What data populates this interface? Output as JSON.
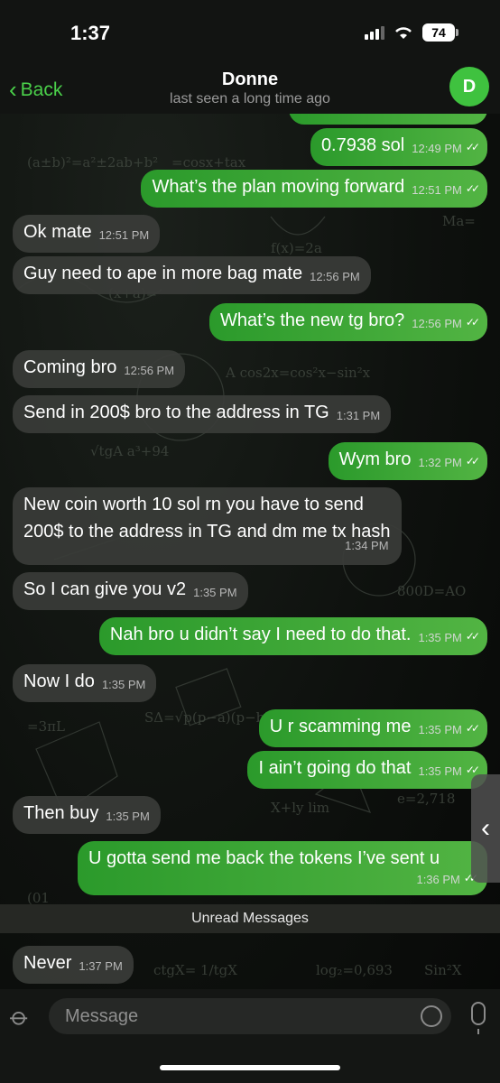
{
  "status": {
    "time": "1:37",
    "battery": "74"
  },
  "header": {
    "back_label": "Back",
    "contact_name": "Donne",
    "last_seen": "last seen a long time ago",
    "avatar_initial": "D"
  },
  "messages": [
    {
      "dir": "out",
      "text": "0.7938 sol",
      "time": "12:49 PM"
    },
    {
      "dir": "out",
      "text": "What’s the plan moving forward",
      "time": "12:51 PM"
    },
    {
      "dir": "in",
      "text": "Ok mate",
      "time": "12:51 PM"
    },
    {
      "dir": "in",
      "text": "Guy need to ape in more bag mate",
      "time": "12:56 PM"
    },
    {
      "dir": "out",
      "text": "What’s the new tg bro?",
      "time": "12:56 PM"
    },
    {
      "dir": "in",
      "text": "Coming bro",
      "time": "12:56 PM"
    },
    {
      "dir": "in",
      "text": "Send in 200$ bro to the address in TG",
      "time": "1:31 PM"
    },
    {
      "dir": "out",
      "text": "Wym bro",
      "time": "1:32 PM"
    },
    {
      "dir": "in",
      "text": "New coin worth 10 sol rn you have to send",
      "text2": "200$ to the address in TG and dm me tx hash",
      "time": "1:34 PM"
    },
    {
      "dir": "in",
      "text": "So I can give you v2",
      "time": "1:35 PM"
    },
    {
      "dir": "out",
      "text": "Nah bro u didn’t say I need to do that.",
      "time": "1:35 PM"
    },
    {
      "dir": "in",
      "text": "Now I do",
      "time": "1:35 PM"
    },
    {
      "dir": "out",
      "text": "U r scamming me",
      "time": "1:35 PM"
    },
    {
      "dir": "out",
      "text": "I ain’t going do that",
      "time": "1:35 PM"
    },
    {
      "dir": "in",
      "text": "Then buy",
      "time": "1:35 PM"
    },
    {
      "dir": "out",
      "text": "U gotta send me back the tokens I’ve sent u",
      "time": "1:36 PM"
    },
    {
      "dir": "in",
      "text": "Never",
      "time": "1:37 PM"
    }
  ],
  "unread_label": "Unread Messages",
  "input": {
    "placeholder": "Message"
  },
  "colors": {
    "accent": "#4ad04a",
    "outgoing": "#3fa83a",
    "incoming": "#3a3c38"
  }
}
